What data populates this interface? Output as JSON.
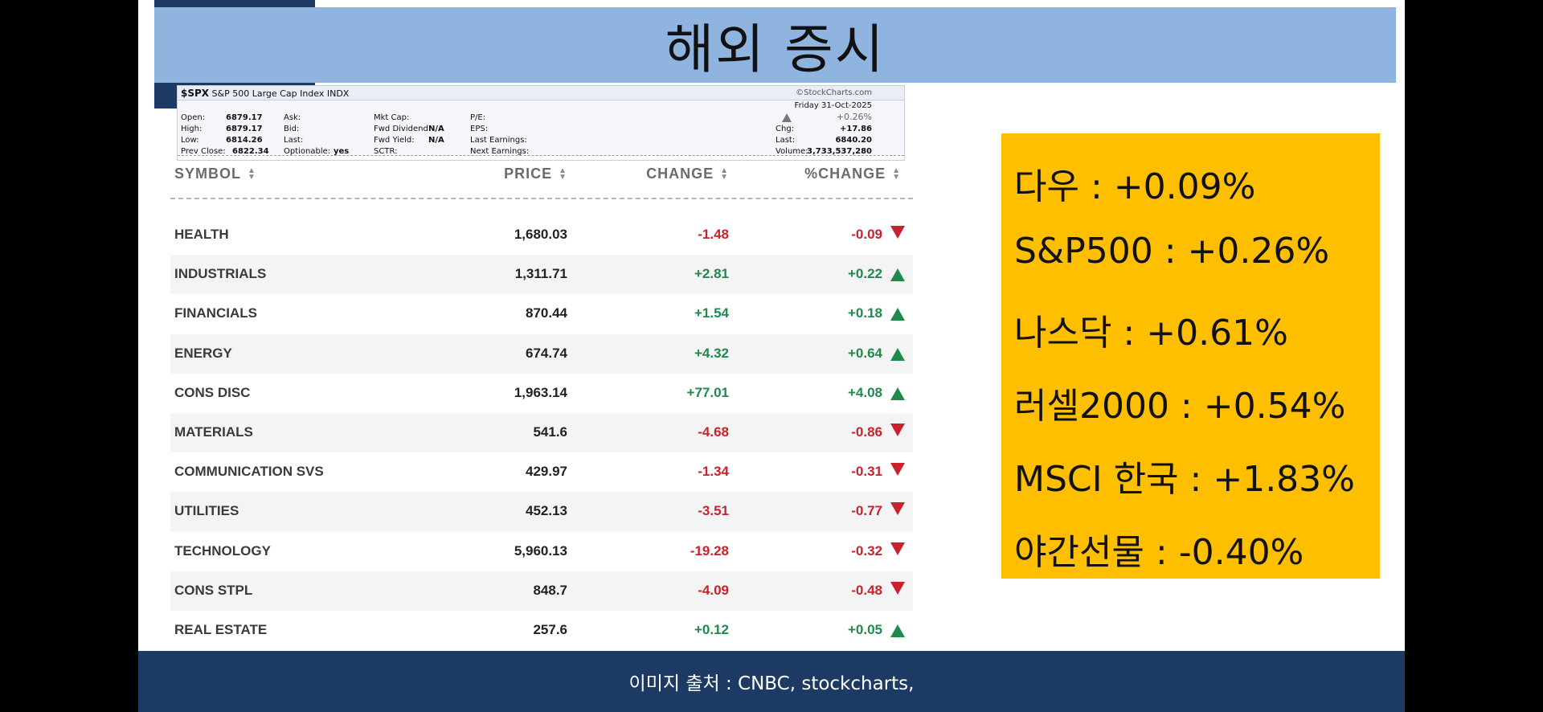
{
  "title": "해외 증시",
  "stockcharts": {
    "symbol": "$SPX",
    "name": "S&P 500 Large Cap Index INDX",
    "source": "©StockCharts.com",
    "date": "Friday  31-Oct-2025",
    "percent": "+0.26%",
    "open_label": "Open:",
    "open": "6879.17",
    "high_label": "High:",
    "high": "6879.17",
    "low_label": "Low:",
    "low": "6814.26",
    "prev_close_label": "Prev Close:",
    "prev_close": "6822.34",
    "ask_label": "Ask:",
    "bid_label": "Bid:",
    "last_label": "Last:",
    "optionable_label": "Optionable:",
    "optionable": "yes",
    "mkt_cap_label": "Mkt Cap:",
    "fwd_dividend_label": "Fwd Dividend:",
    "fwd_dividend": "N/A",
    "fwd_yield_label": "Fwd Yield:",
    "fwd_yield": "N/A",
    "sctr_label": "SCTR:",
    "pe_label": "P/E:",
    "eps_label": "EPS:",
    "last_earnings_label": "Last Earnings:",
    "next_earnings_label": "Next Earnings:",
    "chg_label": "Chg:",
    "chg": "+17.86",
    "last_price_label": "Last:",
    "last_price": "6840.20",
    "volume_label": "Volume:",
    "volume": "3,733,537,280"
  },
  "table": {
    "headers": {
      "symbol": "SYMBOL",
      "price": "PRICE",
      "change": "CHANGE",
      "pct_change": "%CHANGE"
    },
    "rows": [
      {
        "symbol": "HEALTH",
        "price": "1,680.03",
        "change": "-1.48",
        "pct": "-0.09",
        "dir": "down"
      },
      {
        "symbol": "INDUSTRIALS",
        "price": "1,311.71",
        "change": "+2.81",
        "pct": "+0.22",
        "dir": "up"
      },
      {
        "symbol": "FINANCIALS",
        "price": "870.44",
        "change": "+1.54",
        "pct": "+0.18",
        "dir": "up"
      },
      {
        "symbol": "ENERGY",
        "price": "674.74",
        "change": "+4.32",
        "pct": "+0.64",
        "dir": "up"
      },
      {
        "symbol": "CONS DISC",
        "price": "1,963.14",
        "change": "+77.01",
        "pct": "+4.08",
        "dir": "up"
      },
      {
        "symbol": "MATERIALS",
        "price": "541.6",
        "change": "-4.68",
        "pct": "-0.86",
        "dir": "down"
      },
      {
        "symbol": "COMMUNICATION SVS",
        "price": "429.97",
        "change": "-1.34",
        "pct": "-0.31",
        "dir": "down"
      },
      {
        "symbol": "UTILITIES",
        "price": "452.13",
        "change": "-3.51",
        "pct": "-0.77",
        "dir": "down"
      },
      {
        "symbol": "TECHNOLOGY",
        "price": "5,960.13",
        "change": "-19.28",
        "pct": "-0.32",
        "dir": "down"
      },
      {
        "symbol": "CONS STPL",
        "price": "848.7",
        "change": "-4.09",
        "pct": "-0.48",
        "dir": "down"
      },
      {
        "symbol": "REAL ESTATE",
        "price": "257.6",
        "change": "+0.12",
        "pct": "+0.05",
        "dir": "up"
      }
    ]
  },
  "summary": [
    "다우 : +0.09%",
    "S&P500 : +0.26%",
    "나스닥  : +0.61%",
    "러셀2000 : +0.54%",
    "MSCI 한국 : +1.83%",
    "야간선물 : -0.40%"
  ],
  "footer": "이미지 출처  : CNBC, stockcharts,",
  "colors": {
    "title_bar": "#8fb4e0",
    "navy": "#1c3a63",
    "summary_bg": "#fdbf00",
    "positive": "#1f8a4c",
    "negative": "#c8232c"
  }
}
